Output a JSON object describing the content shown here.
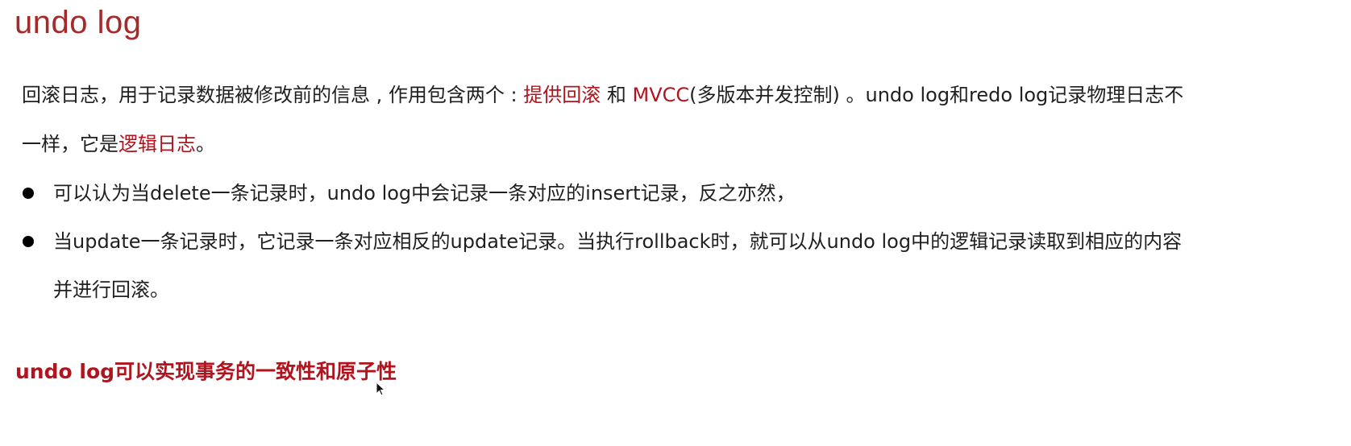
{
  "title": "undo log",
  "intro": {
    "line1": {
      "t1": "回滚日志，用于记录数据被修改前的信息 , 作用包含两个 : ",
      "h1": "提供回滚",
      "t2": " 和 ",
      "h2": "MVCC",
      "t3": "(多版本并发控制) 。undo log和redo log记录物理日志不"
    },
    "line2": {
      "t1": "一样，它是",
      "h1": "逻辑日志",
      "t2": "。"
    }
  },
  "bullets": [
    {
      "line1": "可以认为当delete一条记录时，undo log中会记录一条对应的insert记录，反之亦然，"
    },
    {
      "line1": "当update一条记录时，它记录一条对应相反的update记录。当执行rollback时，就可以从undo log中的逻辑记录读取到相应的内容",
      "line2": "并进行回滚。"
    }
  ],
  "conclusion": "undo log可以实现事务的一致性和原子性",
  "colors": {
    "title": "#a52a2a",
    "highlight": "#b0141e",
    "text": "#1f1f1f"
  },
  "icons": [
    "bullet-dot-icon",
    "mouse-cursor-icon"
  ]
}
